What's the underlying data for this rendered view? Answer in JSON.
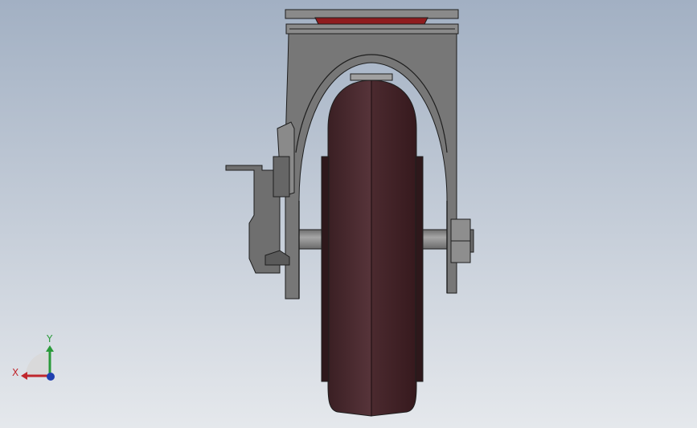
{
  "viewport": {
    "background_top": "#a2b0c3",
    "background_bottom": "#e5e8ec",
    "model": "swivel-caster-with-brake",
    "view": "front"
  },
  "model_colors": {
    "wheel": "#4f2d31",
    "wheel_dark": "#3a1e22",
    "wheel_light": "#5e3a3e",
    "fork": "#777777",
    "fork_dark": "#5a5a5a",
    "fork_light": "#a0a0a0",
    "top_plate": "#8a8a8a",
    "red_washer": "#8e1c1e",
    "axle": "#8b8b8b",
    "outline": "#1e1e1e"
  },
  "triad": {
    "x_label": "X",
    "y_label": "Y",
    "x_color": "#c0272d",
    "y_color": "#2a9a3a",
    "z_color": "#1f3fb0"
  }
}
